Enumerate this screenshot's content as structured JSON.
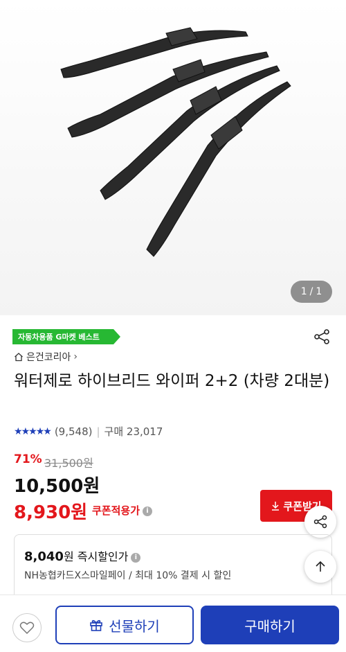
{
  "gallery": {
    "current": "1",
    "separator": "/",
    "total": "1"
  },
  "badge": "자동차용품 G마켓 베스트",
  "seller": {
    "name": "은건코리아",
    "chevron": "›"
  },
  "product": {
    "title": "워터제로 하이브리드 와이퍼 2+2 (차량 2대분)"
  },
  "rating": {
    "stars": 4.5,
    "review_count": "(9,548)",
    "separator": "|",
    "purchase": "구매 23,017"
  },
  "pricing": {
    "discount": "71%",
    "original": "31,500원",
    "price": "10,500원",
    "coupon_price": "8,930원",
    "coupon_label": "쿠폰적용가",
    "coupon_button": "쿠폰받기"
  },
  "instant_discount": {
    "value": "8,040",
    "unit": "원",
    "label": "즉시할인가",
    "description": "NH농협카드X스마일페이 / 최대 10% 결제 시 할인"
  },
  "bottom_bar": {
    "gift_label": "선물하기",
    "buy_label": "구매하기"
  },
  "colors": {
    "accent": "#1e3fb8",
    "sale": "#e3171c",
    "badge": "#27b833"
  },
  "icons": [
    "share-icon",
    "home-icon",
    "info-icon",
    "download-icon",
    "arrow-up-icon",
    "heart-icon",
    "gift-icon"
  ]
}
